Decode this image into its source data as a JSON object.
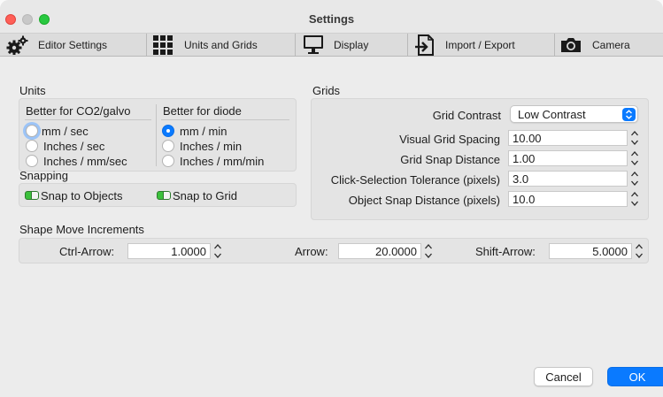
{
  "window": {
    "title": "Settings"
  },
  "tabs": [
    {
      "label": "Editor Settings",
      "icon": "gears-icon"
    },
    {
      "label": "Units and Grids",
      "icon": "grid-icon"
    },
    {
      "label": "Display",
      "icon": "monitor-icon"
    },
    {
      "label": "Import / Export",
      "icon": "import-export-icon"
    },
    {
      "label": "Camera",
      "icon": "camera-icon"
    }
  ],
  "units": {
    "title": "Units",
    "co2": {
      "header": "Better for CO2/galvo",
      "options": [
        "mm / sec",
        "Inches / sec",
        "Inches / mm/sec"
      ],
      "selected_index": 0
    },
    "diode": {
      "header": "Better for diode",
      "options": [
        "mm / min",
        "Inches / min",
        "Inches / mm/min"
      ],
      "selected_index": 0
    }
  },
  "snapping": {
    "title": "Snapping",
    "snap_to_objects": "Snap to Objects",
    "snap_to_grid": "Snap to Grid"
  },
  "grids": {
    "title": "Grids",
    "contrast_label": "Grid Contrast",
    "contrast_value": "Low Contrast",
    "spacing_label": "Visual Grid Spacing",
    "spacing_value": "10.00",
    "snap_distance_label": "Grid Snap Distance",
    "snap_distance_value": "1.00",
    "click_tolerance_label": "Click-Selection Tolerance (pixels)",
    "click_tolerance_value": "3.0",
    "object_snap_label": "Object Snap Distance (pixels)",
    "object_snap_value": "10.0"
  },
  "shape_move": {
    "title": "Shape Move Increments",
    "ctrl_label": "Ctrl-Arrow:",
    "ctrl_value": "1.0000",
    "arrow_label": "Arrow:",
    "arrow_value": "20.0000",
    "shift_label": "Shift-Arrow:",
    "shift_value": "5.0000"
  },
  "buttons": {
    "cancel": "Cancel",
    "ok": "OK"
  },
  "colors": {
    "accent": "#0a7aff",
    "toggle_on": "#3cc13c",
    "close": "#ff5f57",
    "zoom": "#28c840"
  }
}
